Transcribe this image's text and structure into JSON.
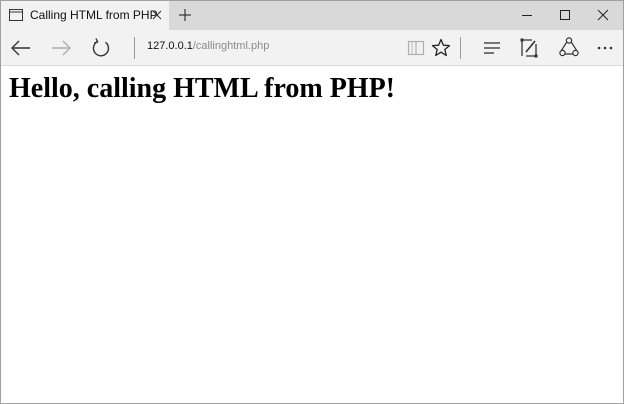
{
  "tab": {
    "title": "Calling HTML from PHP"
  },
  "address": {
    "host": "127.0.0.1",
    "path": "/callinghtml.php"
  },
  "page": {
    "heading": "Hello, calling HTML from PHP!"
  },
  "icons": {
    "tab": "page-icon",
    "tab_close": "close-icon",
    "new_tab": "plus-icon",
    "minimize": "minimize-icon",
    "maximize": "maximize-icon",
    "close": "close-icon",
    "back": "arrow-left-icon",
    "forward": "arrow-right-icon",
    "refresh": "refresh-icon",
    "reading_view": "book-icon",
    "favorite": "star-icon",
    "hub": "hub-icon",
    "web_note": "pen-icon",
    "share": "share-icon",
    "more": "more-icon"
  },
  "colors": {
    "tab_bar": "#d9d9d9",
    "toolbar": "#f2f2f2",
    "page": "#ffffff"
  }
}
